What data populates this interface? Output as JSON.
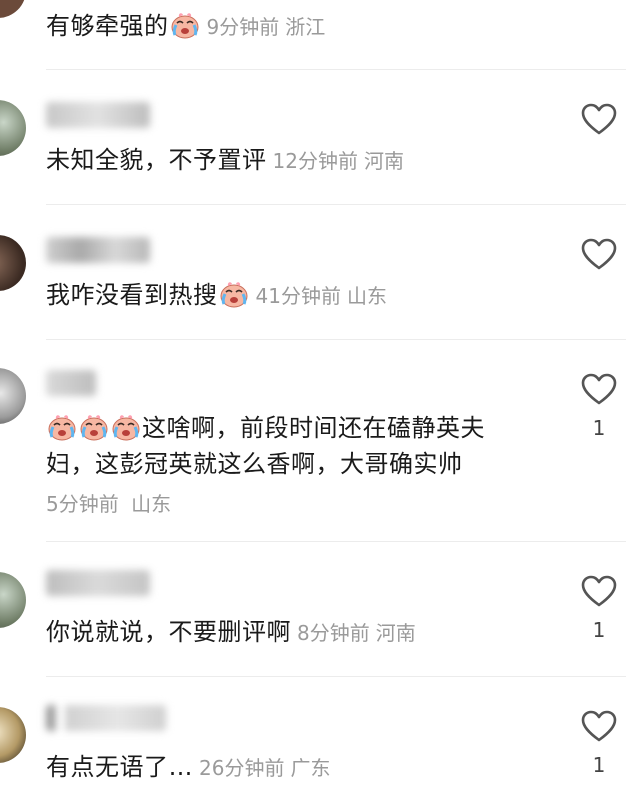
{
  "comments": [
    {
      "text": "有够牵强的",
      "emojis": [
        "crying-face-emoji"
      ],
      "time": "9分钟前",
      "location": "浙江",
      "likes": ""
    },
    {
      "text": "未知全貌，不予置评",
      "emojis": [],
      "time": "12分钟前",
      "location": "河南",
      "likes": ""
    },
    {
      "text": "我咋没看到热搜",
      "emojis": [
        "crying-face-emoji"
      ],
      "time": "41分钟前",
      "location": "山东",
      "likes": ""
    },
    {
      "text_before_line1": "这啥啊，前段时间还在磕静英夫",
      "text_line2": "妇，这彭冠英就这么香啊，大哥确实帅",
      "emojis": [
        "crying-face-emoji",
        "crying-face-emoji",
        "crying-face-emoji"
      ],
      "time": "5分钟前",
      "location": "山东",
      "likes": "1"
    },
    {
      "text": "你说就说，不要删评啊",
      "emojis": [],
      "time": "8分钟前",
      "location": "河南",
      "likes": "1"
    },
    {
      "text": "有点无语了…",
      "emojis": [],
      "time": "26分钟前",
      "location": "广东",
      "likes": "1"
    }
  ],
  "colors": {
    "text": "#1a1a1a",
    "meta": "#9a9a9a",
    "divider": "#ececec",
    "heart_outline": "#555555"
  },
  "icons": {
    "like": "heart-outline-icon"
  }
}
